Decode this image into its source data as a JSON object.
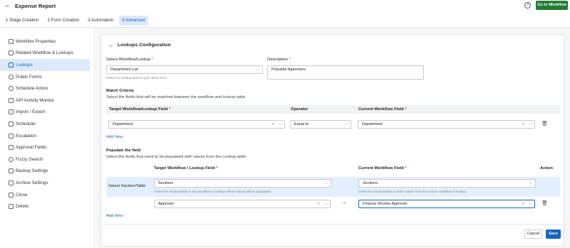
{
  "app": {
    "title": "Expense Report",
    "go_workflow": "Go to Workflow"
  },
  "steps": [
    {
      "label": "1  Stage Creation",
      "active": false
    },
    {
      "label": "2  Form Creation",
      "active": false
    },
    {
      "label": "3  Automation",
      "active": false
    },
    {
      "label": "4  Advanced",
      "active": true
    }
  ],
  "sidebar": {
    "items": [
      {
        "label": "Workflow Properties",
        "icon": "edit-icon"
      },
      {
        "label": "Related Workflow & Lookups",
        "icon": "link-icon"
      },
      {
        "label": "Lookups",
        "icon": "table-icon",
        "active": true
      },
      {
        "label": "Public Forms",
        "icon": "globe-icon"
      },
      {
        "label": "Schedule Action",
        "icon": "clock-icon"
      },
      {
        "label": "API Activity Monitor",
        "icon": "monitor-icon"
      },
      {
        "label": "Import / Export",
        "icon": "import-export-icon"
      },
      {
        "label": "Scheduler",
        "icon": "calendar-icon"
      },
      {
        "label": "Escalation",
        "icon": "escalation-icon"
      },
      {
        "label": "Approval Fields",
        "icon": "approval-icon"
      },
      {
        "label": "Fuzzy Search",
        "icon": "search-icon"
      },
      {
        "label": "Backup Settings",
        "icon": "backup-icon"
      },
      {
        "label": "Archive Settings",
        "icon": "archive-icon"
      },
      {
        "label": "Clone",
        "icon": "clone-icon"
      },
      {
        "label": "Delete",
        "icon": "trash-icon"
      }
    ]
  },
  "lookup": {
    "title": "Lookups Configuration",
    "select_label": "Select Workflow/Lookup",
    "select_value": "Department List",
    "select_hint": "Select the lookup table to pull values from",
    "desc_label": "Description",
    "desc_value": "Populate Approvers",
    "match": {
      "title": "Match Criteria",
      "subtitle": "Select the fields that will be matched between the workflow and lookup table",
      "col_target": "Target Workflow/Lookup Field",
      "col_operator": "Operator",
      "col_current": "Current Workflow Field",
      "row": {
        "target": "Department",
        "operator": "Equal to",
        "current": "Department"
      },
      "add_new": "Add New"
    },
    "populate": {
      "title": "Populate the field",
      "subtitle": "Select the fields that need to be populated with values from the Lookup table",
      "col_target": "Target Workflow / Lookup Field",
      "col_current": "Current Workflow Field",
      "col_action": "Action",
      "section_label": "Select Section/Table",
      "target_section": "Sections",
      "target_hint": "Select the section/table in this workflow or lookup where values will be populated.",
      "current_section": "Sections",
      "current_hint": "Select the section/table to fetch values from the source workflow or lookup.",
      "row": {
        "target": "Approver",
        "arrow": "→",
        "current": "Finance Review Approver"
      },
      "add_new": "Add New"
    },
    "cancel": "Cancel",
    "save": "Save"
  },
  "symbols": {
    "asterisk": "*",
    "clear": "×",
    "chevron": "⌵",
    "back": "←",
    "help": "?",
    "trash": "🗑"
  }
}
